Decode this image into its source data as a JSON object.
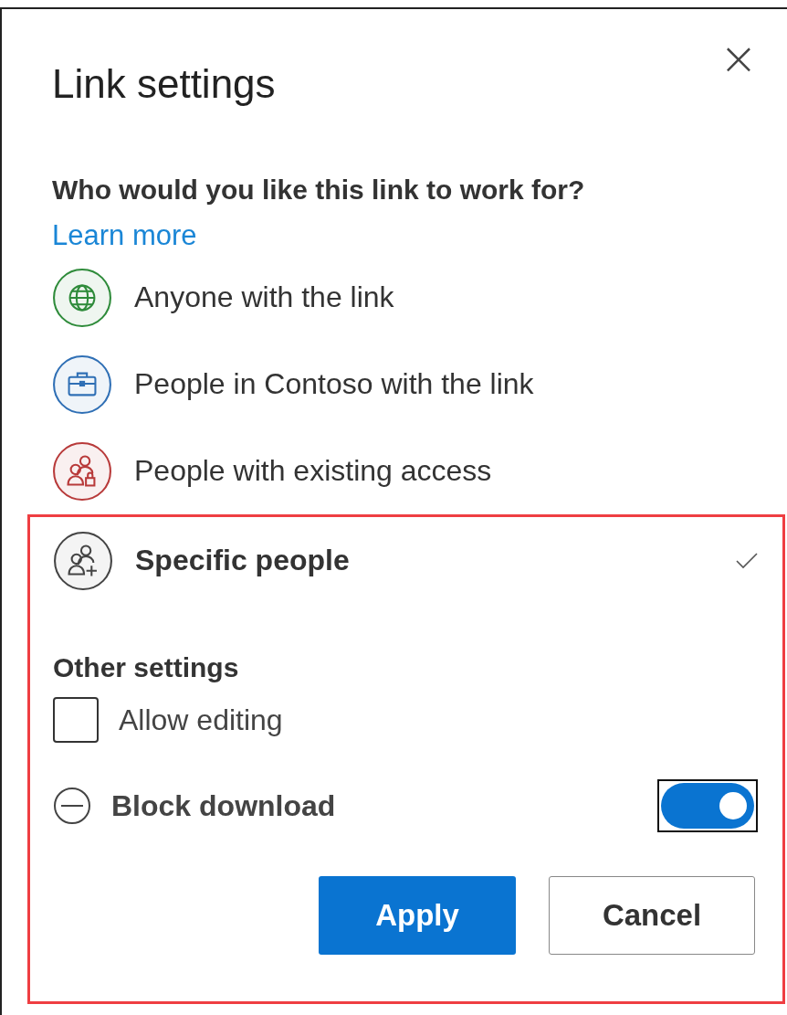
{
  "dialog": {
    "title": "Link settings",
    "close_label": "×"
  },
  "audience": {
    "question": "Who would you like this link to work for?",
    "link": "Learn more",
    "options": [
      {
        "kind": "globe",
        "label": "Anyone with the link",
        "color": "#2e8b3a",
        "selected": false
      },
      {
        "kind": "briefcase",
        "label": "People in Contoso with the link",
        "color": "#2f6fb5",
        "selected": false
      },
      {
        "kind": "people-lock",
        "label": "People with existing access",
        "color": "#b83a3a",
        "selected": false
      },
      {
        "kind": "people-add",
        "label": "Specific people",
        "color": "#444444",
        "selected": true
      }
    ]
  },
  "other_settings": {
    "heading": "Other settings",
    "allow_editing": {
      "label": "Allow editing",
      "checked": false
    },
    "block_download": {
      "label": "Block download",
      "on": true
    }
  },
  "buttons": [
    {
      "kind": "primary",
      "label": "Apply"
    },
    {
      "kind": "secondary",
      "label": "Cancel"
    }
  ]
}
